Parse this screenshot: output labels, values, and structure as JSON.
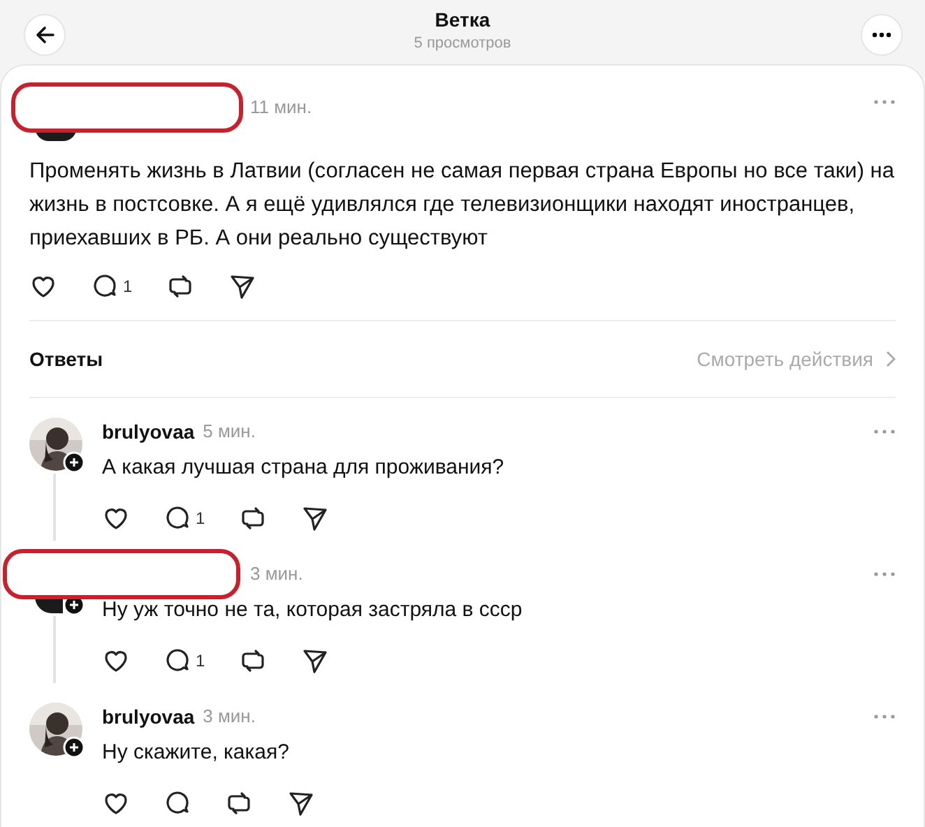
{
  "header": {
    "title": "Ветка",
    "subtitle": "5 просмотров"
  },
  "post": {
    "redacted": true,
    "time": "11 мин.",
    "text": "Променять жизнь в Латвии (согласен не самая первая страна Европы но все таки) на жизнь в постсовке. А я ещё удивлялся где телевизионщики находят иностранцев, приехавших в РБ. А они реально существуют",
    "reply_count": "1"
  },
  "replies_bar": {
    "label": "Ответы",
    "link": "Смотреть действия"
  },
  "replies": [
    {
      "username": "brulyovaa",
      "redacted": false,
      "time": "5 мин.",
      "text": "А какая лучшая страна для проживания?",
      "reply_count": "1"
    },
    {
      "redacted": true,
      "time": "3 мин.",
      "text": "Ну уж точно не та, которая застряла в ссср",
      "reply_count": "1"
    },
    {
      "username": "brulyovaa",
      "redacted": false,
      "time": "3 мин.",
      "text": "Ну скажите, какая?"
    }
  ]
}
